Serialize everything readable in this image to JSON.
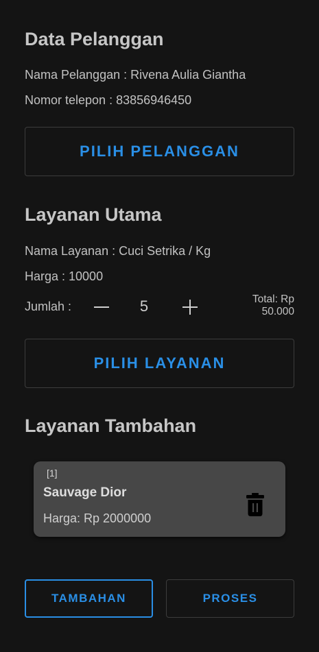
{
  "customer": {
    "heading": "Data Pelanggan",
    "name_line": "Nama Pelanggan : Rivena Aulia Giantha",
    "phone_line": "Nomor telepon : 83856946450",
    "select_button": "PILIH PELANGGAN"
  },
  "main_service": {
    "heading": "Layanan Utama",
    "name_line": "Nama Layanan : Cuci Setrika / Kg",
    "price_line": "Harga : 10000",
    "quantity_label": "Jumlah :",
    "quantity_value": "5",
    "total_line1": "Total: Rp",
    "total_line2": "50.000",
    "select_button": "PILIH LAYANAN"
  },
  "extra_services": {
    "heading": "Layanan Tambahan",
    "items": [
      {
        "index": "[1]",
        "name": "Sauvage Dior",
        "price": "Harga: Rp 2000000",
        "delete_icon": "trash-icon"
      }
    ]
  },
  "actions": {
    "add_button": "TAMBAHAN",
    "process_button": "PROSES"
  },
  "colors": {
    "background": "#141414",
    "accent": "#2a8fe6",
    "card": "#474747"
  }
}
